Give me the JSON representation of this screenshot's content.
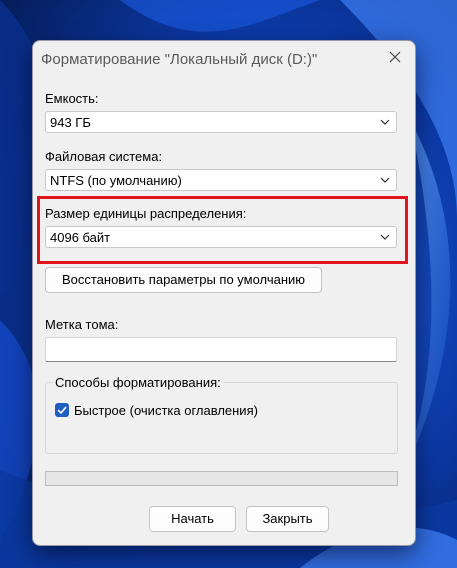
{
  "dialog": {
    "title": "Форматирование \"Локальный диск (D:)\""
  },
  "capacity": {
    "label": "Емкость:",
    "value": "943 ГБ"
  },
  "file_system": {
    "label": "Файловая система:",
    "value": "NTFS (по умолчанию)"
  },
  "allocation_unit": {
    "label": "Размер единицы распределения:",
    "value": "4096 байт"
  },
  "restore_button": {
    "label": "Восстановить параметры по умолчанию"
  },
  "volume_label": {
    "label": "Метка тома:",
    "value": ""
  },
  "format_options": {
    "title": "Способы форматирования:",
    "quick_format_label": "Быстрое (очистка оглавления)",
    "quick_format_checked": true
  },
  "progress": {
    "fraction": 0
  },
  "buttons": {
    "start": "Начать",
    "close": "Закрыть"
  },
  "colors": {
    "highlight": "#e0141b",
    "accent": "#1e5fbf"
  },
  "icons": [
    "close-icon",
    "chevron-down-icon",
    "checkmark-icon"
  ]
}
